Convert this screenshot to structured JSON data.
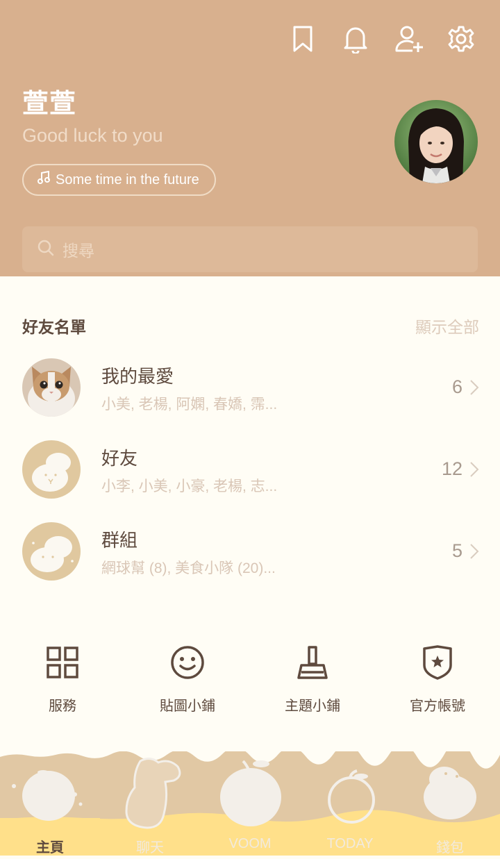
{
  "header": {
    "username": "萱萱",
    "status_message": "Good luck to you",
    "music": "Some time in the future",
    "search_placeholder": "搜尋",
    "icons": [
      "bookmark-icon",
      "bell-icon",
      "add-friend-icon",
      "gear-icon"
    ]
  },
  "friends_section": {
    "title": "好友名單",
    "show_all": "顯示全部",
    "rows": [
      {
        "title": "我的最愛",
        "subtitle": "小美, 老楊, 阿嫻, 春嬌, 霈...",
        "count": "6"
      },
      {
        "title": "好友",
        "subtitle": "小李, 小美, 小豪, 老楊, 志...",
        "count": "12"
      },
      {
        "title": "群組",
        "subtitle": "網球幫 (8), 美食小隊 (20)...",
        "count": "5"
      }
    ]
  },
  "services": [
    {
      "label": "服務",
      "icon": "grid-icon"
    },
    {
      "label": "貼圖小鋪",
      "icon": "smiley-icon"
    },
    {
      "label": "主題小鋪",
      "icon": "brush-icon"
    },
    {
      "label": "官方帳號",
      "icon": "shield-star-icon"
    }
  ],
  "tabs": [
    {
      "label": "主頁",
      "active": true
    },
    {
      "label": "聊天",
      "active": false
    },
    {
      "label": "VOOM",
      "active": false
    },
    {
      "label": "TODAY",
      "active": false
    },
    {
      "label": "錢包",
      "active": false
    }
  ],
  "colors": {
    "header_bg": "#D8B08E",
    "body_bg": "#FFFDF5",
    "text_dark": "#5E4A3E",
    "text_muted": "#D9C6B6",
    "tab_bg": "#E1C8A4",
    "tab_highlight": "#FFE08A"
  }
}
